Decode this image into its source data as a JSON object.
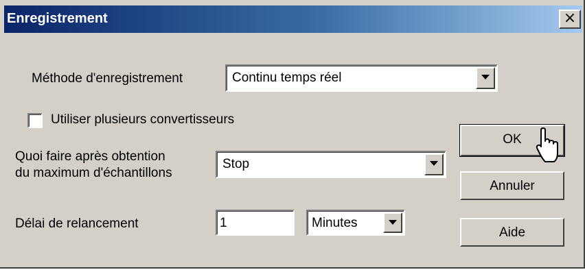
{
  "window": {
    "title": "Enregistrement",
    "close_glyph": "×"
  },
  "method": {
    "label": "Méthode d'enregistrement",
    "value": "Continu temps réel"
  },
  "multi_converters": {
    "label": "Utiliser plusieurs convertisseurs",
    "checked": false
  },
  "after_max": {
    "label_line1": "Quoi faire après obtention",
    "label_line2": "du maximum d'échantillons",
    "value": "Stop"
  },
  "restart_delay": {
    "label": "Délai de relancement",
    "value": "1",
    "unit": "Minutes"
  },
  "buttons": {
    "ok": "OK",
    "cancel": "Annuler",
    "help": "Aide"
  },
  "icons": {
    "close": "close-icon",
    "dropdown": "chevron-down-icon",
    "cursor": "hand-pointer-cursor"
  },
  "colors": {
    "dialog_bg": "#d4d0c8",
    "titlebar_start": "#0a246a",
    "titlebar_end": "#a6caf0"
  }
}
